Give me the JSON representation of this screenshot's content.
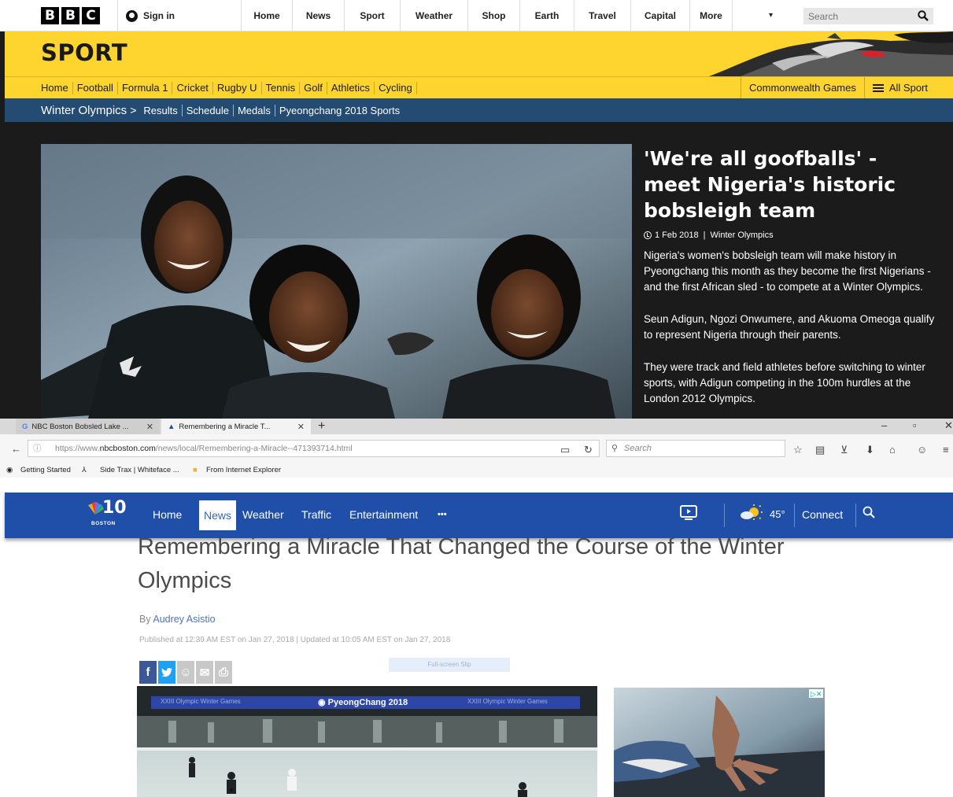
{
  "bbc": {
    "logo_letters": [
      "B",
      "B",
      "C"
    ],
    "signin": "Sign in",
    "topnav": [
      {
        "label": "Home",
        "left": 0
      },
      {
        "label": "News"
      },
      {
        "label": "Sport"
      },
      {
        "label": "Weather"
      },
      {
        "label": "Shop"
      },
      {
        "label": "Earth"
      },
      {
        "label": "Travel"
      },
      {
        "label": "Capital"
      },
      {
        "label": "More"
      }
    ],
    "search_placeholder": "Search",
    "section_title": "SPORT",
    "sport_nav": [
      "Home",
      "Football",
      "Formula 1",
      "Cricket",
      "Rugby U",
      "Tennis",
      "Golf",
      "Athletics",
      "Cycling"
    ],
    "commonwealth": "Commonwealth Games",
    "all_sport": "All Sport",
    "breadcrumb": {
      "section": "Winter Olympics",
      "arrow": ">",
      "links": [
        "Results",
        "Schedule",
        "Medals",
        "Pyeongchang 2018 Sports"
      ]
    },
    "headline": "'We're all goofballs' - meet Nigeria's historic bobsleigh team",
    "date": "1 Feb 2018",
    "tag": "Winter Olympics",
    "paragraphs": [
      "Nigeria's women's bobsleigh team will make history in Pyeongchang this month as they become the first Nigerians - and the first African sled - to compete at a Winter Olympics.",
      "Seun Adigun, Ngozi Onwumere, and Akuoma Omeoga qualify to represent Nigeria through their parents.",
      "They were track and field athletes before switching to winter sports, with Adigun competing in the 100m hurdles at the London 2012 Olympics."
    ]
  },
  "browser": {
    "tabs": [
      "NBC Boston Bobsled Lake ...",
      "Remembering a Miracle T..."
    ],
    "url_prefix": "https://www.",
    "url_domain": "nbcboston.com",
    "url_path": "/news/local/Remembering-a-Miracle--471393714.html",
    "search_placeholder": "Search",
    "bookmarks": [
      "Getting Started",
      "Side Trax | Whiteface ...",
      "From Internet Explorer"
    ]
  },
  "nbc": {
    "logo_number": "10",
    "logo_city": "BOSTON",
    "nav": [
      "Home",
      "News",
      "Weather",
      "Traffic",
      "Entertainment",
      "•••"
    ],
    "temperature": "45°",
    "connect": "Connect",
    "title": "Remembering a Miracle That Changed the Course of the Winter Olympics",
    "by": "By",
    "author": "Audrey Asistio",
    "published": "Published at 12:39 AM EST on Jan 27, 2018 | Updated at 10:05 AM EST on Jan 27, 2018",
    "fullscreen": "Full-screen Slip",
    "video_banner_left": "XXIII Olympic Winter Games",
    "video_banner_center": "PyeongChang 2018",
    "video_banner_right": "XXIII Olympic Winter Games",
    "share_colors": {
      "facebook": "#3b5998",
      "twitter": "#1da1f2",
      "grey": "#c8c8c8"
    }
  }
}
